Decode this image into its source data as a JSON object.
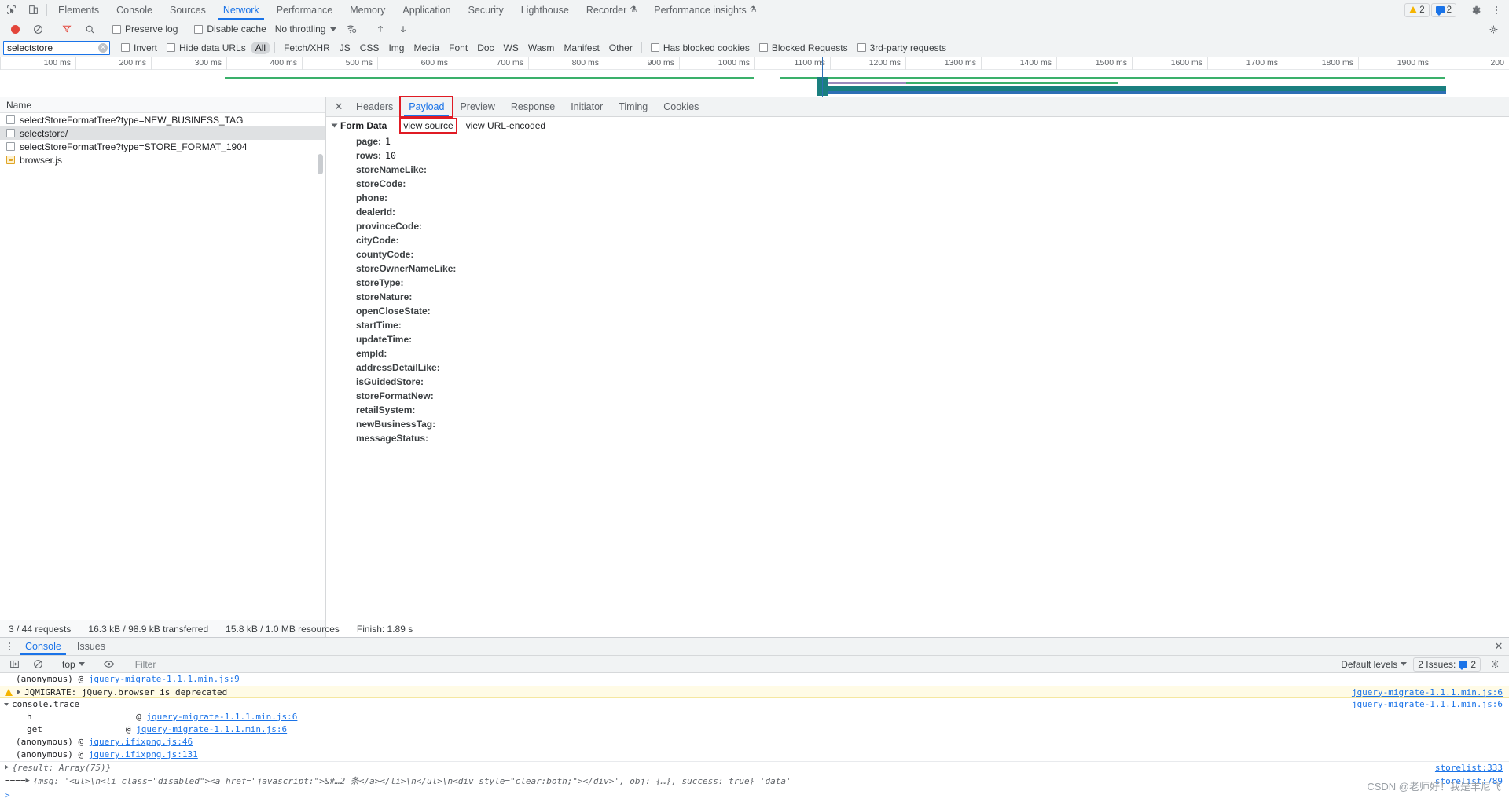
{
  "main_tabs": [
    {
      "label": "Elements",
      "active": false,
      "flask": false
    },
    {
      "label": "Console",
      "active": false,
      "flask": false
    },
    {
      "label": "Sources",
      "active": false,
      "flask": false
    },
    {
      "label": "Network",
      "active": true,
      "flask": false
    },
    {
      "label": "Performance",
      "active": false,
      "flask": false
    },
    {
      "label": "Memory",
      "active": false,
      "flask": false
    },
    {
      "label": "Application",
      "active": false,
      "flask": false
    },
    {
      "label": "Security",
      "active": false,
      "flask": false
    },
    {
      "label": "Lighthouse",
      "active": false,
      "flask": false
    },
    {
      "label": "Recorder",
      "active": false,
      "flask": true
    },
    {
      "label": "Performance insights",
      "active": false,
      "flask": true
    }
  ],
  "tabbar_right": {
    "warning_count": "2",
    "message_count": "2",
    "settings_icon": "gear-icon",
    "more_icon": "kebab-icon"
  },
  "network_toolbar": {
    "record_icon": "record-dot-icon",
    "clear_icon": "clear-circle-slash-icon",
    "filter_icon": "filter-funnel-icon",
    "search_icon": "search-magnifier-icon",
    "preserve_log_label": "Preserve log",
    "preserve_log_checked": false,
    "disable_cache_label": "Disable cache",
    "disable_cache_checked": false,
    "throttling_label": "No throttling",
    "wifi_icon": "wifi-settings-icon",
    "import_icon": "import-arrow-up-icon",
    "export_icon": "export-arrow-down-icon",
    "settings_icon": "gear-icon"
  },
  "filter_bar": {
    "filter_value": "selectstore",
    "filter_placeholder": "Filter",
    "clear_icon": "clear-x-icon",
    "invert_label": "Invert",
    "invert_checked": false,
    "hide_data_urls_label": "Hide data URLs",
    "hide_data_urls_checked": false,
    "types": [
      {
        "label": "All",
        "active": true
      },
      {
        "label": "Fetch/XHR",
        "active": false
      },
      {
        "label": "JS",
        "active": false
      },
      {
        "label": "CSS",
        "active": false
      },
      {
        "label": "Img",
        "active": false
      },
      {
        "label": "Media",
        "active": false
      },
      {
        "label": "Font",
        "active": false
      },
      {
        "label": "Doc",
        "active": false
      },
      {
        "label": "WS",
        "active": false
      },
      {
        "label": "Wasm",
        "active": false
      },
      {
        "label": "Manifest",
        "active": false
      },
      {
        "label": "Other",
        "active": false
      }
    ],
    "has_blocked_cookies_label": "Has blocked cookies",
    "has_blocked_cookies_checked": false,
    "blocked_requests_label": "Blocked Requests",
    "blocked_requests_checked": false,
    "third_party_label": "3rd-party requests",
    "third_party_checked": false
  },
  "overview": {
    "ticks": [
      "100 ms",
      "200 ms",
      "300 ms",
      "400 ms",
      "500 ms",
      "600 ms",
      "700 ms",
      "800 ms",
      "900 ms",
      "1000 ms",
      "1100 ms",
      "1200 ms",
      "1300 ms",
      "1400 ms",
      "1500 ms",
      "1600 ms",
      "1700 ms",
      "1800 ms",
      "1900 ms",
      "200"
    ],
    "green_color": "#3ab06a",
    "teal_color": "#1a7f7f",
    "purple_color": "#9b8bbd",
    "blue_color": "#2d6fb5",
    "marker_color": "#a83a8a"
  },
  "requests": {
    "column_header": "Name",
    "rows": [
      {
        "name": "selectStoreFormatTree?type=NEW_BUSINESS_TAG",
        "icon": "checkbox-doc-icon",
        "selected": false,
        "alt": false
      },
      {
        "name": "selectstore/",
        "icon": "checkbox-doc-icon",
        "selected": true,
        "alt": false
      },
      {
        "name": "selectStoreFormatTree?type=STORE_FORMAT_1904",
        "icon": "checkbox-doc-icon",
        "selected": false,
        "alt": false
      },
      {
        "name": "browser.js",
        "icon": "js-file-icon",
        "selected": false,
        "alt": false
      }
    ]
  },
  "status_bar": {
    "requests": "3 / 44 requests",
    "transferred": "16.3 kB / 98.9 kB transferred",
    "resources": "15.8 kB / 1.0 MB resources",
    "finish": "Finish: 1.89 s"
  },
  "detail": {
    "close_icon": "close-x-icon",
    "tabs": [
      {
        "label": "Headers",
        "active": false,
        "highlight": false
      },
      {
        "label": "Payload",
        "active": true,
        "highlight": true
      },
      {
        "label": "Preview",
        "active": false,
        "highlight": false
      },
      {
        "label": "Response",
        "active": false,
        "highlight": false
      },
      {
        "label": "Initiator",
        "active": false,
        "highlight": false
      },
      {
        "label": "Timing",
        "active": false,
        "highlight": false
      },
      {
        "label": "Cookies",
        "active": false,
        "highlight": false
      }
    ],
    "form_data_title": "Form Data",
    "view_source_label": "view source",
    "view_url_encoded_label": "view URL-encoded",
    "form_data": [
      {
        "key": "page:",
        "value": "1"
      },
      {
        "key": "rows:",
        "value": "10"
      },
      {
        "key": "storeNameLike:",
        "value": ""
      },
      {
        "key": "storeCode:",
        "value": ""
      },
      {
        "key": "phone:",
        "value": ""
      },
      {
        "key": "dealerId:",
        "value": ""
      },
      {
        "key": "provinceCode:",
        "value": ""
      },
      {
        "key": "cityCode:",
        "value": ""
      },
      {
        "key": "countyCode:",
        "value": ""
      },
      {
        "key": "storeOwnerNameLike:",
        "value": ""
      },
      {
        "key": "storeType:",
        "value": ""
      },
      {
        "key": "storeNature:",
        "value": ""
      },
      {
        "key": "openCloseState:",
        "value": ""
      },
      {
        "key": "startTime:",
        "value": ""
      },
      {
        "key": "updateTime:",
        "value": ""
      },
      {
        "key": "empId:",
        "value": ""
      },
      {
        "key": "addressDetailLike:",
        "value": ""
      },
      {
        "key": "isGuidedStore:",
        "value": ""
      },
      {
        "key": "storeFormatNew:",
        "value": ""
      },
      {
        "key": "retailSystem:",
        "value": ""
      },
      {
        "key": "newBusinessTag:",
        "value": ""
      },
      {
        "key": "messageStatus:",
        "value": ""
      }
    ]
  },
  "drawer": {
    "tabs": [
      {
        "label": "Console",
        "active": true
      },
      {
        "label": "Issues",
        "active": false
      }
    ],
    "close_icon": "close-x-icon",
    "toolbar": {
      "sidebar_icon": "show-console-sidebar-icon",
      "clear_icon": "clear-console-icon",
      "context_label": "top",
      "eye_icon": "live-expression-eye-icon",
      "filter_placeholder": "Filter",
      "filter_value": "",
      "levels_label": "Default levels",
      "issues_label": "2 Issues:",
      "issues_count": "2",
      "settings_icon": "gear-icon"
    },
    "log_entries": [
      {
        "type": "stack",
        "indent": 1,
        "text": "(anonymous) @ ",
        "link": "jquery-migrate-1.1.1.min.js:9",
        "right_link": ""
      },
      {
        "type": "warning",
        "indent": 0,
        "text": "JQMIGRATE: jQuery.browser is deprecated",
        "link": "",
        "right_link": "jquery-migrate-1.1.1.min.js:6"
      },
      {
        "type": "trace",
        "indent": 0,
        "text": "console.trace",
        "link": "",
        "right_link": "jquery-migrate-1.1.1.min.js:6"
      },
      {
        "type": "stack",
        "indent": 2,
        "text": "h                    @ ",
        "link": "jquery-migrate-1.1.1.min.js:6",
        "right_link": ""
      },
      {
        "type": "stack",
        "indent": 2,
        "text": "get                @ ",
        "link": "jquery-migrate-1.1.1.min.js:6",
        "right_link": ""
      },
      {
        "type": "stack",
        "indent": 1,
        "text": "(anonymous) @ ",
        "link": "jquery.ifixpng.js:46",
        "right_link": ""
      },
      {
        "type": "stack",
        "indent": 1,
        "text": "(anonymous) @ ",
        "link": "jquery.ifixpng.js:131",
        "right_link": ""
      },
      {
        "type": "object",
        "indent": 0,
        "prefix": "▶",
        "text": "{result: Array(75)}",
        "link": "",
        "right_link": "storelist:333"
      },
      {
        "type": "object",
        "indent": 0,
        "prefix": "▶",
        "text": "{msg: '<ul>\\n<li class=\"disabled\"><a href=\"javascript:\">&#…2 条</a></li>\\n</ul>\\n<div style=\"clear:both;\"></div>', obj: {…}, success: true} 'data'",
        "link": "",
        "right_link": "storelist:789"
      }
    ],
    "prompt": ">"
  },
  "watermark": "CSDN @老师好！我是羊尼飞"
}
